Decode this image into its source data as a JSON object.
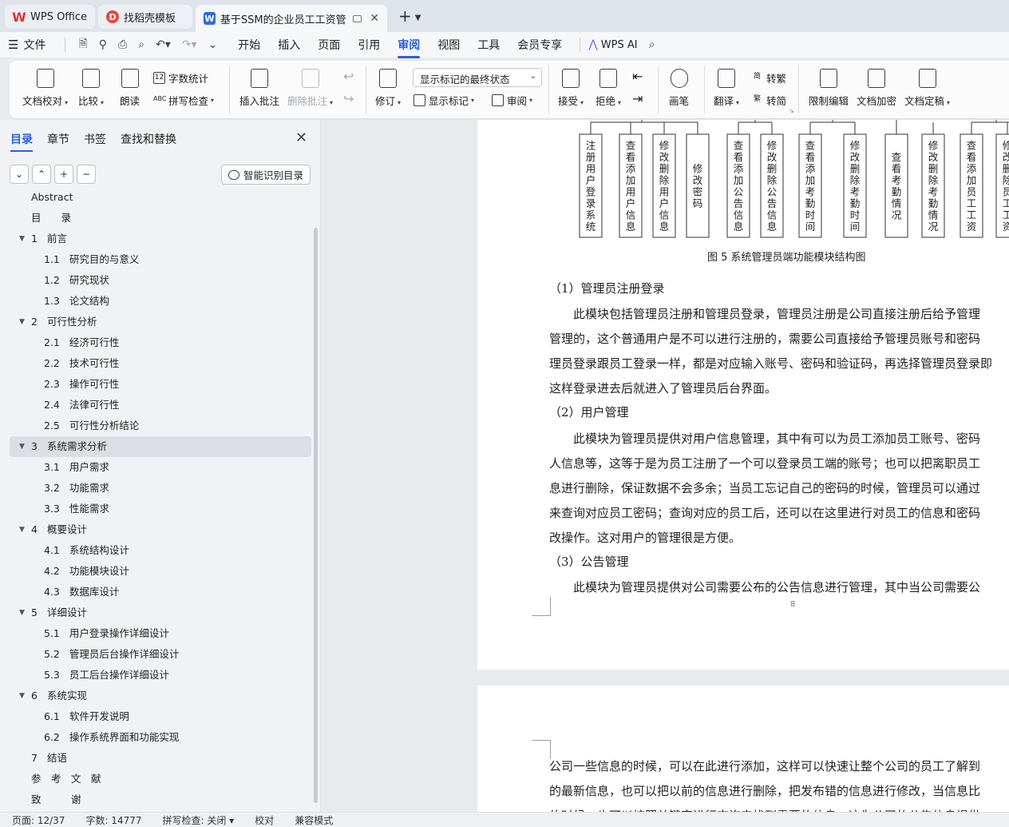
{
  "tabs": [
    {
      "label": "WPS Office",
      "icon": "wps-logo-icon",
      "active": false
    },
    {
      "label": "找稻壳模板",
      "icon": "daoke-icon",
      "active": false
    },
    {
      "label": "基于SSM的企业员工工资管理",
      "icon": "word-doc-icon",
      "active": true
    }
  ],
  "menubar": {
    "file": "文件",
    "items": [
      "开始",
      "插入",
      "页面",
      "引用",
      "审阅",
      "视图",
      "工具",
      "会员专享"
    ],
    "selected": "审阅",
    "wps_ai": "WPS AI"
  },
  "ribbon": {
    "doc_check": "文档校对",
    "compare": "比较",
    "read_aloud": "朗读",
    "word_count": "字数统计",
    "spell_check": "拼写检查",
    "insert_comment": "插入批注",
    "delete_comment": "删除批注",
    "revise": "修订",
    "markup_state": "显示标记的最终状态",
    "show_markup": "显示标记",
    "review": "审阅",
    "accept": "接受",
    "reject": "拒绝",
    "pen": "画笔",
    "translate": "翻译",
    "to_traditional": "转繁",
    "to_simplified": "转简",
    "restrict_edit": "限制编辑",
    "doc_encrypt": "文档加密",
    "doc_finalize": "文档定稿"
  },
  "nav": {
    "tabs": [
      "目录",
      "章节",
      "书签",
      "查找和替换"
    ],
    "active_tab": "目录",
    "smart_btn": "智能识别目录",
    "toc": [
      {
        "num": "",
        "text": "Abstract",
        "level": 0,
        "expand": false
      },
      {
        "num": "",
        "text": "目　　录",
        "level": 0,
        "expand": false
      },
      {
        "num": "1",
        "text": "前言",
        "level": 1,
        "expand": true
      },
      {
        "num": "1.1",
        "text": "研究目的与意义",
        "level": 2
      },
      {
        "num": "1.2",
        "text": "研究现状",
        "level": 2
      },
      {
        "num": "1.3",
        "text": "论文结构",
        "level": 2
      },
      {
        "num": "2",
        "text": "可行性分析",
        "level": 1,
        "expand": true
      },
      {
        "num": "2.1",
        "text": "经济可行性",
        "level": 2
      },
      {
        "num": "2.2",
        "text": "技术可行性",
        "level": 2
      },
      {
        "num": "2.3",
        "text": "操作可行性",
        "level": 2
      },
      {
        "num": "2.4",
        "text": "法律可行性",
        "level": 2
      },
      {
        "num": "2.5",
        "text": "可行性分析结论",
        "level": 2
      },
      {
        "num": "3",
        "text": "系统需求分析",
        "level": 1,
        "expand": true,
        "selected": true
      },
      {
        "num": "3.1",
        "text": "用户需求",
        "level": 2
      },
      {
        "num": "3.2",
        "text": "功能需求",
        "level": 2
      },
      {
        "num": "3.3",
        "text": "性能需求",
        "level": 2
      },
      {
        "num": "4",
        "text": "概要设计",
        "level": 1,
        "expand": true
      },
      {
        "num": "4.1",
        "text": "系统结构设计",
        "level": 2
      },
      {
        "num": "4.2",
        "text": "功能模块设计",
        "level": 2
      },
      {
        "num": "4.3",
        "text": "数据库设计",
        "level": 2
      },
      {
        "num": "5",
        "text": "详细设计",
        "level": 1,
        "expand": true
      },
      {
        "num": "5.1",
        "text": "用户登录操作详细设计",
        "level": 2
      },
      {
        "num": "5.2",
        "text": "管理员后台操作详细设计",
        "level": 2
      },
      {
        "num": "5.3",
        "text": "员工后台操作详细设计",
        "level": 2
      },
      {
        "num": "6",
        "text": "系统实现",
        "level": 1,
        "expand": true
      },
      {
        "num": "6.1",
        "text": "软件开发说明",
        "level": 2
      },
      {
        "num": "6.2",
        "text": "操作系统界面和功能实现",
        "level": 2
      },
      {
        "num": "7",
        "text": "结语",
        "level": 0
      },
      {
        "num": "",
        "text": "参　考　文　献",
        "level": 0
      },
      {
        "num": "",
        "text": "致　　　谢",
        "level": 0
      }
    ]
  },
  "diagram": {
    "boxes": [
      "注册用户登录系统",
      "查看添加用户信息",
      "修改删除用户信息",
      "修改密码",
      "查看添加公告信息",
      "修改删除公告信息",
      "查看添加考勤时间",
      "修改删除考勤时间",
      "查看考勤情况",
      "修改删除考勤情况",
      "查看添加员工工资",
      "修改删除员工工资"
    ],
    "caption": "图 5  系统管理员端功能模块结构图"
  },
  "doc": {
    "h1": "（1）管理员注册登录",
    "p1": [
      "　　此模块包括管理员注册和管理员登录，管理员注册是公司直接注册后给予管理",
      "管理的，这个普通用户是不可以进行注册的，需要公司直接给予管理员账号和密码",
      "理员登录跟员工登录一样，都是对应输入账号、密码和验证码，再选择管理员登录即",
      "这样登录进去后就进入了管理员后台界面。"
    ],
    "h2": "（2）用户管理",
    "p2": [
      "　　此模块为管理员提供对用户信息管理，其中有可以为员工添加员工账号、密码",
      "人信息等，这等于是为员工注册了一个可以登录员工端的账号；也可以把离职员工",
      "息进行删除，保证数据不会多余；当员工忘记自己的密码的时候，管理员可以通过",
      "来查询对应员工密码；查询对应的员工后，还可以在这里进行对员工的信息和密码",
      "改操作。这对用户的管理很是方便。"
    ],
    "h3": "（3）公告管理",
    "p3": [
      "　　此模块为管理员提供对公司需要公布的公告信息进行管理，其中当公司需要公"
    ],
    "page_number": "8",
    "p4": [
      "公司一些信息的时候，可以在此进行添加，这样可以快速让整个公司的员工了解到",
      "的最新信息，也可以把以前的信息进行删除，把发布错的信息进行修改，当信息比",
      "的时候，也可以按照关键字进行查询来找到需要的信息，这为公司的公告信息提供"
    ]
  },
  "status": {
    "page": "页面: 12/37",
    "words": "字数: 14777",
    "spell": "拼写检查: 关闭",
    "proof": "校对",
    "compat": "兼容模式"
  }
}
